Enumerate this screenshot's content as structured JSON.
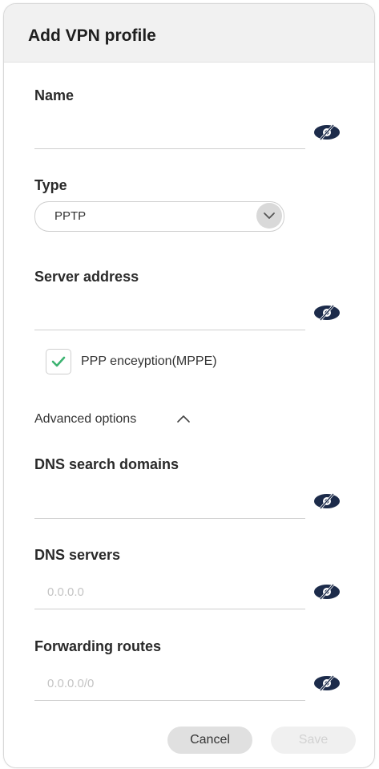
{
  "dialog": {
    "title": "Add VPN profile"
  },
  "fields": {
    "name": {
      "label": "Name",
      "value": "",
      "placeholder": ""
    },
    "type": {
      "label": "Type",
      "selected": "PPTP"
    },
    "server_address": {
      "label": "Server address",
      "value": "",
      "placeholder": ""
    },
    "ppp_encryption": {
      "label": "PPP enceyption(MPPE)",
      "checked": true
    },
    "advanced": {
      "label": "Advanced options",
      "expanded": true
    },
    "dns_search_domains": {
      "label": "DNS search domains",
      "value": "",
      "placeholder": ""
    },
    "dns_servers": {
      "label": "DNS servers",
      "value": "",
      "placeholder": "0.0.0.0"
    },
    "forwarding_routes": {
      "label": "Forwarding routes",
      "value": "",
      "placeholder": "0.0.0.0/0"
    }
  },
  "buttons": {
    "cancel": "Cancel",
    "save": "Save"
  },
  "icons": {
    "visibility": "eye-slash-icon",
    "dropdown": "chevron-down-icon",
    "advanced": "chevron-up-icon",
    "check": "check-icon"
  },
  "colors": {
    "check": "#3cb371",
    "icon_dark": "#1c2b4a",
    "header_bg": "#f1f1f1"
  }
}
